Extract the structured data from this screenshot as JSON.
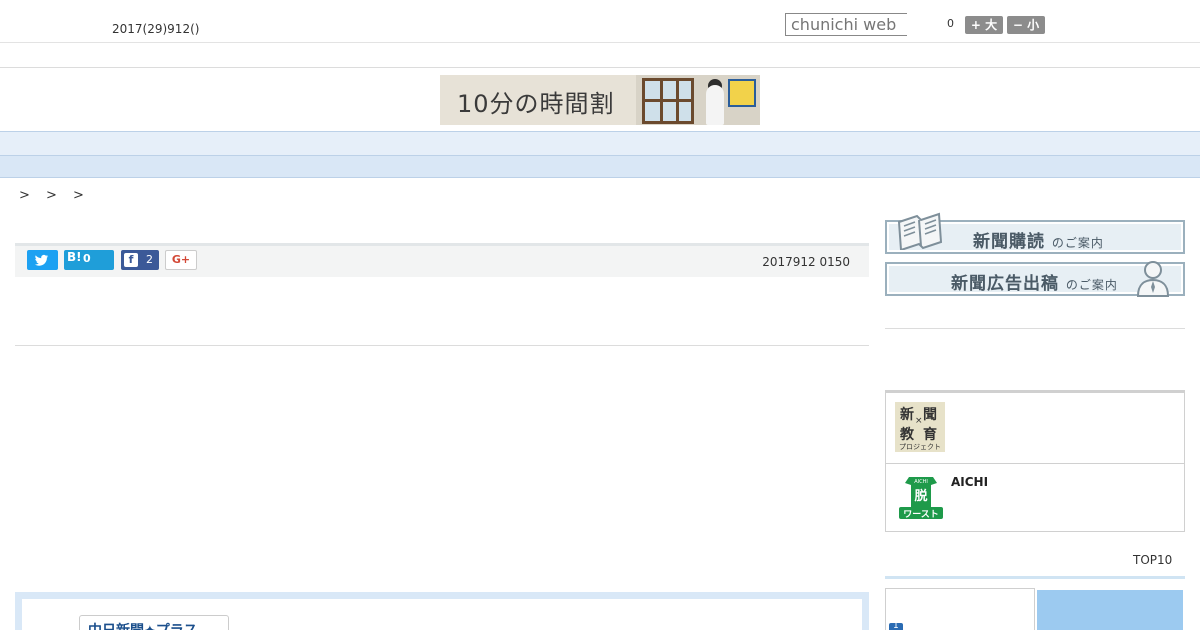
{
  "header": {
    "date": "2017(29)912()",
    "search_placeholder": "chunichi web",
    "font_size_count": "0",
    "font_large_label": "+ 大",
    "font_small_label": "− 小"
  },
  "banner": {
    "text": "10分の時間割"
  },
  "nav": {
    "items": [
      "",
      "",
      "",
      "",
      "",
      "",
      "",
      "",
      ""
    ]
  },
  "breadcrumb": {
    "text": "> > >"
  },
  "share": {
    "hatena_logo": "B!",
    "hatena_count": "0",
    "facebook_logo": "f",
    "facebook_count": "2",
    "gplus_label": "G+"
  },
  "article": {
    "date": "2017912 0150"
  },
  "plus_box": {
    "logo_text": "中日新聞✦プラス"
  },
  "sidebar": {
    "subscribe_main": "新聞購読",
    "subscribe_small": "のご案内",
    "ad_main": "新聞広告出稿",
    "ad_small": "のご案内",
    "edu_logo": {
      "c1": "新",
      "c2": "聞",
      "cross": "×",
      "c3": "教",
      "c4": "育",
      "sub": "プロジェクト"
    },
    "aichi_logo_top": "AICHI",
    "aichi_logo_mid": "脱",
    "aichi_logo_bottom": "ワースト",
    "aichi_title": "AICHI",
    "top10_label": "TOP10",
    "rank_first": "1"
  },
  "colors": {
    "nav_bg": "#e6eff9",
    "accent_blue": "#9ccaf0",
    "twitter": "#1da1f2",
    "hatena": "#1f9ed9",
    "facebook": "#3b5998",
    "aichi_green": "#1e9a4a"
  }
}
